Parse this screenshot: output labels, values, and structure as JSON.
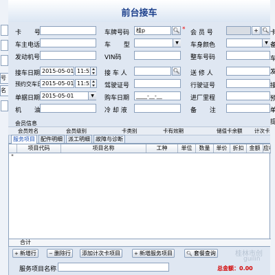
{
  "window": {
    "title": "前台接车"
  },
  "left_strip": {
    "tabs": [
      "号",
      "名"
    ]
  },
  "right_strip": {
    "labels": [
      "卡",
      "备",
      "车",
      "发",
      "接",
      "预",
      "单",
      "提",
      "报",
      "注"
    ]
  },
  "form": {
    "card_no": {
      "label": "卡 号",
      "value": ""
    },
    "plate_no": {
      "label": "车牌号码",
      "value": "桂p"
    },
    "member_no": {
      "label": "会 员 号",
      "value": ""
    },
    "owner_phone": {
      "label": "车主电话",
      "value": ""
    },
    "vehicle_type": {
      "label": "车 型",
      "value": ""
    },
    "body_color": {
      "label": "车身颜色",
      "value": ""
    },
    "engine_no": {
      "label": "发动机号",
      "value": ""
    },
    "vin": {
      "label": "VIN码",
      "value": ""
    },
    "frame_no": {
      "label": "整车号码",
      "value": ""
    },
    "receive_date": {
      "label": "接车日期",
      "date": "2015-05-01",
      "time": "11:55"
    },
    "receiver": {
      "label": "接 车 人",
      "value": ""
    },
    "sender": {
      "label": "送 修 人",
      "value": ""
    },
    "planned_delivery": {
      "label": "预约交车日",
      "date": "2015-05-01",
      "time": "11:55"
    },
    "license_no": {
      "label": "驾驶证号",
      "value": ""
    },
    "driving_permit": {
      "label": "行驶证号",
      "value": ""
    },
    "bill_date": {
      "label": "单据日期",
      "date": "2015-05-01"
    },
    "purchase_date": {
      "label": "购车日期",
      "value": "____-__-__"
    },
    "mileage_in": {
      "label": "进厂里程",
      "value": ""
    },
    "oil": {
      "label": "机 油",
      "value": ""
    },
    "coolant": {
      "label": "冷 却 液",
      "value": ""
    },
    "remarks": {
      "label": "备 注",
      "value": ""
    }
  },
  "member_info": {
    "title": "会员信息",
    "columns": [
      "会员姓名",
      "会员级别",
      "卡类别",
      "卡有效期",
      "储值卡余额",
      "计次卡"
    ]
  },
  "tabs": [
    {
      "label": "服务项目",
      "active": true
    },
    {
      "label": "配件明细",
      "active": false
    },
    {
      "label": "派工明细",
      "active": false
    },
    {
      "label": "故障与诊断",
      "active": false
    }
  ],
  "grid": {
    "columns": [
      "项目代码",
      "项目名称",
      "工种",
      "单位",
      "数量",
      "单价",
      "折扣",
      "金额",
      "应收"
    ],
    "row_indicator": "*",
    "footer_label": "合计"
  },
  "toolbar": {
    "new_row": "新增行",
    "delete_row": "删除行",
    "add_count_card": "添加计次卡项目",
    "new_service": "新增服务项目",
    "view_query": "套餐查询"
  },
  "bottom": {
    "service_name_label": "服务项目名称",
    "service_name_value": "",
    "total_label": "总金额：",
    "total_value": "0.00"
  },
  "watermark": {
    "line1": "桂林市创",
    "line2": "guilin"
  },
  "colors": {
    "title": "#1b3f8b",
    "required": "#e00000",
    "total": "#d40000",
    "active_tab": "#1a4fb4"
  },
  "icons": {
    "search": "magnifier-icon",
    "plus": "plus-icon",
    "dropdown": "chevron-down-icon",
    "new": "plus-icon",
    "delete": "minus-icon",
    "query": "magnifier-icon"
  }
}
